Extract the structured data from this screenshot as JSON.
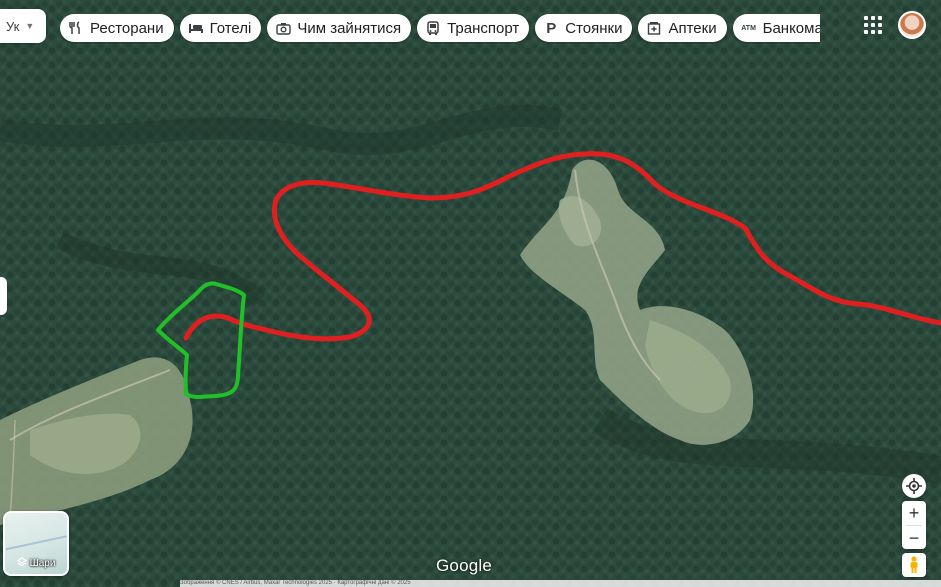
{
  "search": {
    "text": "Ук"
  },
  "categories": [
    {
      "label": "Ресторани",
      "icon": "fork-knife-icon"
    },
    {
      "label": "Готелі",
      "icon": "bed-icon"
    },
    {
      "label": "Чим зайнятися",
      "icon": "camera-icon"
    },
    {
      "label": "Транспорт",
      "icon": "bus-icon"
    },
    {
      "label": "Стоянки",
      "icon": "parking-icon"
    },
    {
      "label": "Аптеки",
      "icon": "pharmacy-icon"
    },
    {
      "label": "Банкомат",
      "icon": "atm-icon"
    }
  ],
  "layers": {
    "label": "Шари"
  },
  "map": {
    "brand": "Google",
    "attribution": "Зображення © CNES / Airbus, Maxar Technologies 2025 · Картографічні дані © 2025",
    "route_color": "#e02020",
    "area_color": "#22c028"
  }
}
